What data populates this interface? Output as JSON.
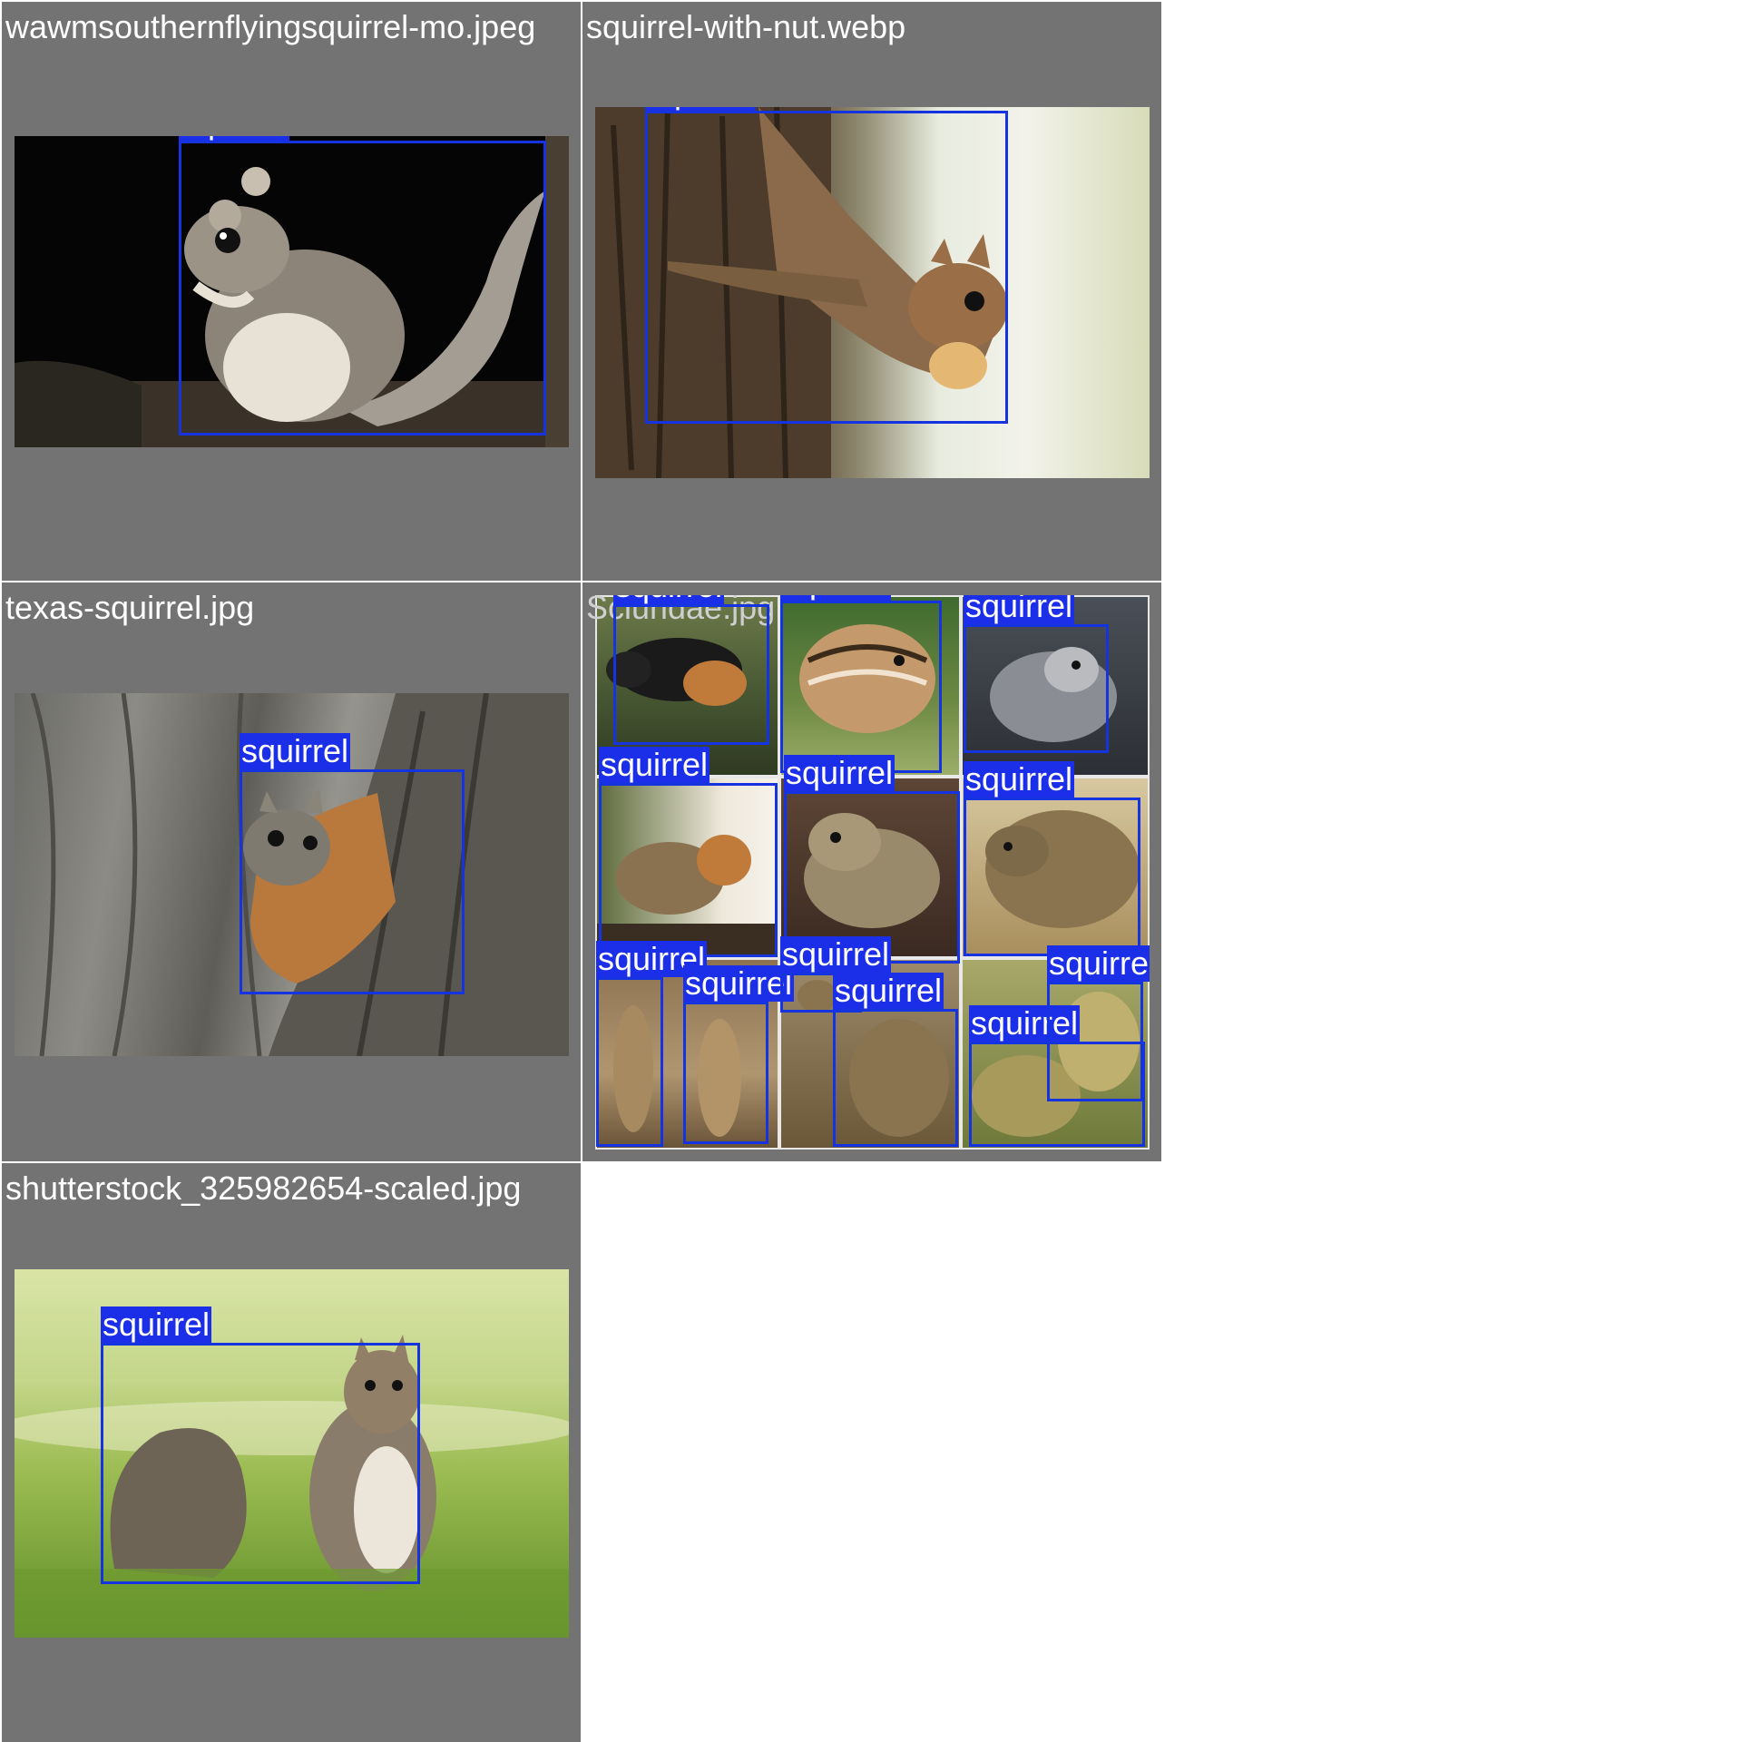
{
  "tiles": [
    {
      "filename": "wawmsouthernflyingsquirrel-mo.jpeg",
      "detections": [
        {
          "label": "squirrel"
        }
      ]
    },
    {
      "filename": "squirrel-with-nut.webp",
      "detections": [
        {
          "label": "squirrel"
        }
      ]
    },
    {
      "filename": "texas-squirrel.jpg",
      "detections": [
        {
          "label": "squirrel"
        }
      ]
    },
    {
      "filename": "Sciuridae.jpg",
      "detections": [
        {
          "label": "squirrel"
        },
        {
          "label": "squirrel"
        },
        {
          "label": "squirrel"
        },
        {
          "label": "squirrel"
        },
        {
          "label": "squirrel"
        },
        {
          "label": "squirrel"
        },
        {
          "label": "squirrel"
        },
        {
          "label": "squirrel"
        },
        {
          "label": "squirrel"
        },
        {
          "label": "squirrel"
        },
        {
          "label": "squirrel"
        },
        {
          "label": "squirrel"
        }
      ]
    },
    {
      "filename": "shutterstock_325982654-scaled.jpg",
      "detections": [
        {
          "label": "squirrel"
        }
      ]
    }
  ],
  "colors": {
    "tile_background": "#737373",
    "box_color": "#1633e0",
    "label_background": "#1b2ee8",
    "label_text": "#ffffff"
  }
}
